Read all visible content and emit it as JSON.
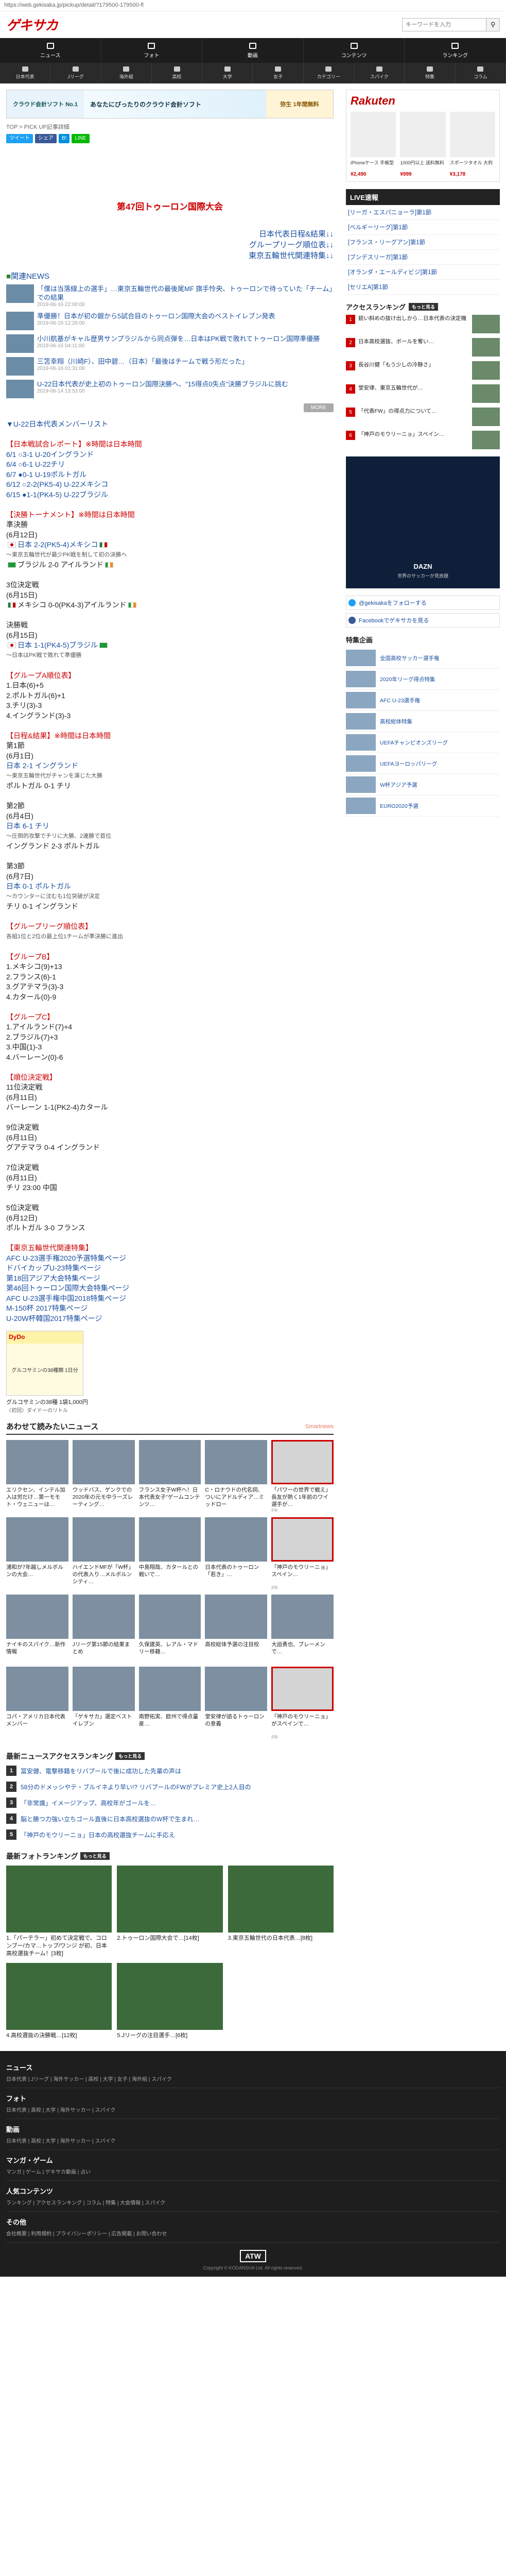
{
  "url": "https://web.gekisaka.jp/pickup/detail/?179500-179500-fl",
  "logo": "ゲキサカ",
  "search": {
    "placeholder": "キーワードを入力"
  },
  "gnav": [
    "ニュース",
    "フォト",
    "動画",
    "コンテンツ",
    "ランキング"
  ],
  "subnav": [
    "日本代表",
    "Jリーグ",
    "海外組",
    "高校",
    "大学",
    "女子",
    "カテゴリー",
    "スパイク",
    "特集",
    "コラム"
  ],
  "ad_top": {
    "a1": "クラウド会計ソフト No.1",
    "a2": "あなたにぴったりのクラウド会計ソフト",
    "a3": "弥生 1年間無料"
  },
  "breadcrumb": "TOP > PICK UP記事詳細",
  "share": [
    "ツイート",
    "シェア",
    "B!",
    "LINE"
  ],
  "hero": {
    "title": "第47回トゥーロン国際大会",
    "links": [
      "日本代表日程&結果↓↓",
      "グループリーグ順位表↓↓",
      "東京五輪世代関連特集↓↓"
    ]
  },
  "news": {
    "title": "関連NEWS",
    "items": [
      {
        "title": "「僕は当落線上の選手」…東京五輪世代の最後尾MF 旗手怜央、トゥーロンで待っていた「チーム」での結果",
        "date": "2019-06-16 22:00:00"
      },
      {
        "title": "準優勝！日本が初の銀から5試合目のトゥーロン国際大会のベストイレブン発表",
        "date": "2019-06-16 12:26:00"
      },
      {
        "title": "小川航基がキャル歴男サンプラジルから同点弾を…日本はPK戦で敗れてトゥーロン国際準優勝",
        "date": "2019-06-16 04:11:00"
      },
      {
        "title": "三笘幸翔（川崎F）、田中碧…（日本）「最後はチームで戦う形だった」",
        "date": "2019-06-16 01:31:00"
      },
      {
        "title": "U-22日本代表が史上初のトゥーロン国際決勝へ、\"15得点0失点\"決勝ブラジルに挑む",
        "date": "2019-06-14 13:53:00"
      }
    ],
    "more": "MORE"
  },
  "body": {
    "members_link": "U-22日本代表メンバーリスト",
    "results_title": "【日本戦試合レポート】※時間は日本時間",
    "results": [
      "6/1 ○3-1 U-20イングランド",
      "6/4 ○6-1 U-22チリ",
      "6/7 ●0-1 U-19ポルトガル",
      "6/12 ○2-2(PK5-4) U-22メキシコ",
      "6/15 ●1-1(PK4-5) U-22ブラジル"
    ],
    "knockout_title": "【決勝トーナメント】※時間は日本時間",
    "sf_label": "準決勝",
    "sf_date": "(6月12日)",
    "sf1": "日本 2-2(PK5-4)メキシコ",
    "sf1_note": "〜東京五輪世代が最少PK戦を制して初の決勝へ",
    "sf2": "ブラジル 2-0 アイルランド",
    "third_label": "3位決定戦",
    "third_date": "(6月15日)",
    "third": "メキシコ 0-0(PK4-3)アイルランド",
    "final_label": "決勝戦",
    "final_date": "(6月15日)",
    "final": "日本 1-1(PK4-5)ブラジル",
    "final_note": "〜日本はPK戦で敗れて準優勝",
    "gl_title": "【グループA順位表】",
    "gl_a": [
      "1.日本(6)+5",
      "2.ポルトガル(6)+1",
      "3.チリ(3)-3",
      "4.イングランド(3)-3"
    ],
    "gl_results_title": "【日程&結果】※時間は日本時間",
    "gl_days": [
      {
        "label": "第1節",
        "date": "(6月1日)",
        "m1": "日本 2-1 イングランド",
        "n1": "〜東京五輪世代がチャンを演じた大勝",
        "m2": "ポルトガル 0-1 チリ"
      },
      {
        "label": "第2節",
        "date": "(6月4日)",
        "m1": "日本 6-1 チリ",
        "n1": "〜圧倒的攻撃でチリに大勝、2連勝で首位",
        "m2": "イングランド 2-3 ポルトガル"
      },
      {
        "label": "第3節",
        "date": "(6月7日)",
        "m1": "日本 0-1 ポルトガル",
        "n1": "〜カウンターに沈むも1位突破が決定",
        "m2": "チリ 0-1 イングランド"
      }
    ],
    "other_groups_title": "【グループリーグ順位表】",
    "other_groups_note": "各組1位と2位の最上位1チームが準決勝に進出",
    "gb_title": "【グループB】",
    "gb": [
      "1.メキシコ(9)+13",
      "2.フランス(6)-1",
      "3.グアテマラ(3)-3",
      "4.カタール(0)-9"
    ],
    "gc_title": "【グループC】",
    "gc": [
      "1.アイルランド(7)+4",
      "2.ブラジル(7)+3",
      "3.中国(1)-3",
      "4.バーレーン(0)-6"
    ],
    "place_title": "【順位決定戦】",
    "place": [
      {
        "label": "11位決定戦",
        "date": "(6月11日)",
        "m": "バーレーン 1-1(PK2-4)カタール"
      },
      {
        "label": "9位決定戦",
        "date": "(6月11日)",
        "m": "グアテマラ 0-4 イングランド"
      },
      {
        "label": "7位決定戦",
        "date": "(6月11日)",
        "m": "チリ 23:00 中国"
      },
      {
        "label": "5位決定戦",
        "date": "(6月12日)",
        "m": "ポルトガル 3-0 フランス"
      }
    ],
    "special_title": "【東京五輪世代関連特集】",
    "special": [
      "AFC U-23選手権2020予選特集ページ",
      "ドバイカップU-23特集ページ",
      "第18回アジア大会特集ページ",
      "第46回トゥーロン国際大会特集ページ",
      "AFC U-23選手権中国2018特集ページ",
      "M-150杯 2017特集ページ",
      "U-20W杯韓国2017特集ページ"
    ]
  },
  "product": {
    "tag": "DyDo",
    "text": "グルコサミンの38種類 1日分",
    "caption": "グルコサミンの38種 1袋1,000円",
    "caption2": "〈初回〉ダイドーのリトル"
  },
  "smart": {
    "title": "あわせて読みたいニュース",
    "by": "Smartnews",
    "cards": [
      {
        "cap": "エリクセン、インテル加入は労だけ…第一モモト・ウェニューは…",
        "src": ""
      },
      {
        "cap": "ウッドバス、ゲンクでの2020年の元モ中ラーズレーティング…",
        "src": ""
      },
      {
        "cap": "フランス女子W杯へ！日本代表女子\"ゲームコンテンツ…",
        "src": ""
      },
      {
        "cap": "C・ロナウドの代名詞、ついにアドルディア…ミッドロー",
        "src": ""
      },
      {
        "cap": "「パワーの世界で戦え」長友が熱く1年前のワイ選手が…",
        "src": "PR"
      },
      {
        "cap": "浦和が7年越しメルボルンの大会…",
        "src": ""
      },
      {
        "cap": "ハイエンドMFが「W杯」の代表入り…メルボルンシティ…",
        "src": ""
      },
      {
        "cap": "中島翔哉、カタールとの戦いで…",
        "src": ""
      },
      {
        "cap": "日本代表のトゥーロン「若き」…",
        "src": ""
      },
      {
        "cap": "「神戸のモウリーニョ」スペイン…",
        "src": "PR"
      },
      {
        "cap": "ナイキのスパイク…新作情報",
        "src": ""
      },
      {
        "cap": "Jリーグ第15節の結果まとめ",
        "src": ""
      },
      {
        "cap": "久保建英、レアル・マドリー移籍…",
        "src": ""
      },
      {
        "cap": "高校総体予選の注目校",
        "src": ""
      },
      {
        "cap": "大迫勇也、ブレーメンで…",
        "src": ""
      },
      {
        "cap": "コパ・アメリカ日本代表メンバー",
        "src": ""
      },
      {
        "cap": "「ゲキサカ」選定ベストイレブン",
        "src": ""
      },
      {
        "cap": "南野拓実、欧州で得点量産…",
        "src": ""
      },
      {
        "cap": "堂安律が語るトゥーロンの意義",
        "src": ""
      },
      {
        "cap": "「神戸のモウリーニョ」がスペインで…",
        "src": "PR"
      }
    ]
  },
  "ranking": {
    "title": "最新ニュースアクセスランキング",
    "tag": "もっと見る",
    "items": [
      "冨安健、電撃移籍をリバプールで後に成功した先輩の声は",
      "58分のドメッシやテ・ブルイネより早い!? リバプールのFWがプレミア史上2人目の",
      "「非常識」イメージアップ、高校年がゴールを…",
      "脳と勝つ力強い立ちゴール直後に日本高校選抜のW杯で生まれ…",
      "「神戸のモウリーニョ」日本の高校選抜チームに手応え"
    ]
  },
  "photo_rank": {
    "title": "最新フォトランキング",
    "tag": "もっと見る",
    "items": [
      "1.「パーテラー」初めて決定戦で、コロンブー/カマ…トップ/ワンジ が初、日本高校選抜チーム！[3枚]",
      "2.トゥーロン国際大会で…[14枚]",
      "3.東京五輪世代の日本代表…[8枚]",
      "4.高校選抜の決勝戦…[12枚]",
      "5.Jリーグの注目選手…[6枚]"
    ]
  },
  "side": {
    "rakuten_logo": "Rakuten",
    "rakuten_items": [
      {
        "t": "iPhoneケース 手帳型",
        "p": "¥2,490"
      },
      {
        "t": "1000円以上 送料無料",
        "p": "¥999"
      },
      {
        "t": "スポーツタオル 大判",
        "p": "¥3,178"
      }
    ],
    "live_title": "LIVE速報",
    "live_items": [
      "[リーガ・エスパニョーラ]第1節",
      "[ベルギーリーグ]第1節",
      "[フランス・リーグアン]第1節",
      "[ブンデスリーガ]第1節",
      "[オランダ・エールディビジ]第1節",
      "[セリエA]第1節"
    ],
    "access_title": "アクセスランキング",
    "access_tag": "もっと見る",
    "access_items": [
      "鋭い斜めの抜け出しから…日本代表の決定機",
      "日本高校選抜、ボールを奪い…",
      "長谷川健「もう少しの冷静さ」",
      "堂安律、東京五輪世代が…",
      "「代表FW」の得点力について…",
      "「神戸のモウリーニョ」スペイン…"
    ],
    "ad_title": "DAZN",
    "ad_sub": "世界のサッカーが見放題",
    "follow_tw": "@gekisakaをフォローする",
    "follow_fb": "Facebookでゲキサカを見る",
    "special_title": "特集企画",
    "specials": [
      "全国高校サッカー選手権",
      "2020年リーグ得点特集",
      "AFC U-23選手権",
      "高校総体特集",
      "UEFAチャンピオンズリーグ",
      "UEFAヨーロッパリーグ",
      "W杯アジア予選",
      "EURO2020予選"
    ]
  },
  "footer": [
    {
      "h": "ニュース",
      "l": "日本代表 | Jリーグ | 海外サッカー | 高校 | 大学 | 女子 | 海外組 | スパイク"
    },
    {
      "h": "フォト",
      "l": "日本代表 | 高校 | 大学 | 海外サッカー | スパイク"
    },
    {
      "h": "動画",
      "l": "日本代表 | 高校 | 大学 | 海外サッカー | スパイク"
    },
    {
      "h": "マンガ・ゲーム",
      "l": "マンガ | ゲーム | ゲキサカ動画 | 占い"
    },
    {
      "h": "人気コンテンツ",
      "l": "ランキング | アクセスランキング | コラム | 特集 | 大会情報 | スパイク"
    },
    {
      "h": "その他",
      "l": "会社概要 | 利用規約 | プライバシーポリシー | 広告掲載 | お問い合わせ"
    }
  ],
  "copyright": "Copyright © KODANSHA Ltd. All rights reserved."
}
